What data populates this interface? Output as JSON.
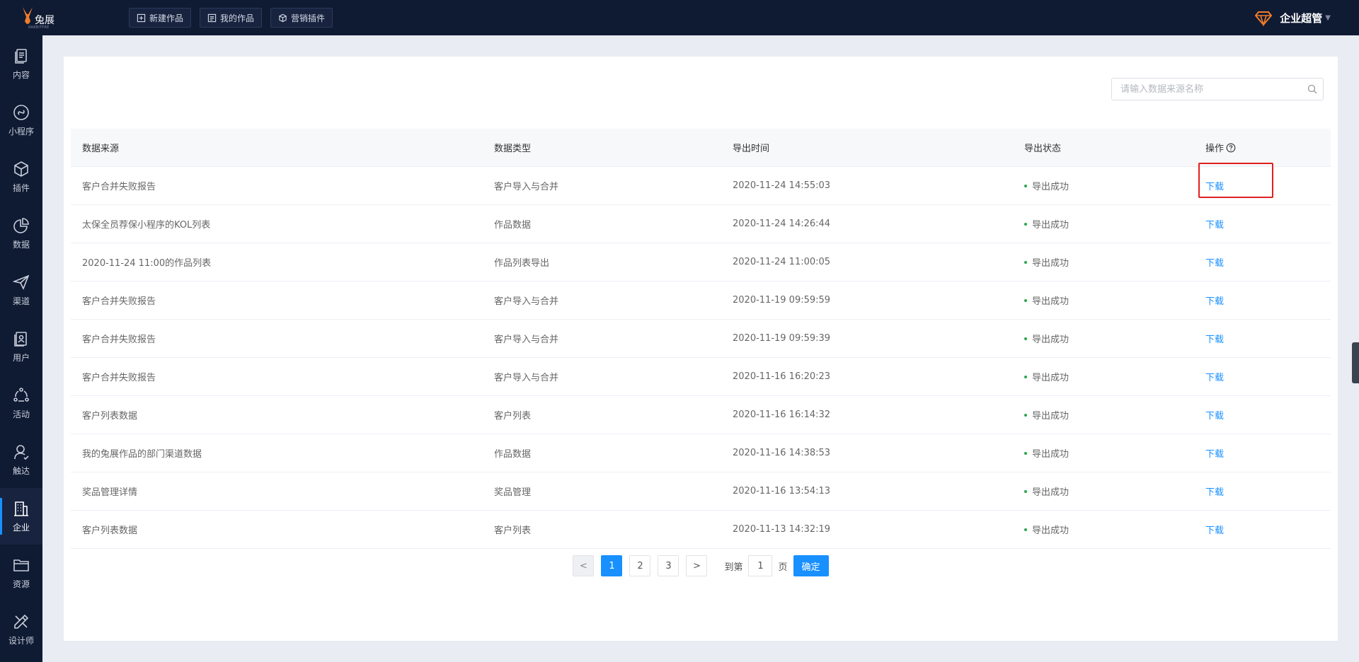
{
  "app": {
    "logo_text": "兔展",
    "logo_sub": "RABBITPRE"
  },
  "top_nav": [
    {
      "label": "新建作品",
      "icon": "plus-square-icon"
    },
    {
      "label": "我的作品",
      "icon": "doc-list-icon"
    },
    {
      "label": "营销插件",
      "icon": "cube-icon"
    }
  ],
  "user": {
    "name": "企业超管",
    "icon": "gem-icon"
  },
  "sidebar": {
    "items": [
      {
        "label": "内容",
        "icon": "content-icon"
      },
      {
        "label": "小程序",
        "icon": "miniprogram-icon"
      },
      {
        "label": "插件",
        "icon": "plugin-icon"
      },
      {
        "label": "数据",
        "icon": "pie-chart-icon"
      },
      {
        "label": "渠道",
        "icon": "send-icon"
      },
      {
        "label": "用户",
        "icon": "user-card-icon"
      },
      {
        "label": "活动",
        "icon": "activity-icon"
      },
      {
        "label": "触达",
        "icon": "reach-icon"
      },
      {
        "label": "企业",
        "icon": "building-icon",
        "active": true
      },
      {
        "label": "资源",
        "icon": "folder-icon"
      },
      {
        "label": "设计师",
        "icon": "designer-icon"
      }
    ]
  },
  "search": {
    "placeholder": "请输入数据来源名称",
    "value": ""
  },
  "table": {
    "headers": {
      "source": "数据来源",
      "type": "数据类型",
      "time": "导出时间",
      "status": "导出状态",
      "action": "操作"
    },
    "rows": [
      {
        "source": "客户合并失败报告",
        "type": "客户导入与合并",
        "time": "2020-11-24 14:55:03",
        "status": "导出成功",
        "action": "下载"
      },
      {
        "source": "太保全员荐保小程序的KOL列表",
        "type": "作品数据",
        "time": "2020-11-24 14:26:44",
        "status": "导出成功",
        "action": "下载"
      },
      {
        "source": "2020-11-24 11:00的作品列表",
        "type": "作品列表导出",
        "time": "2020-11-24 11:00:05",
        "status": "导出成功",
        "action": "下载"
      },
      {
        "source": "客户合并失败报告",
        "type": "客户导入与合并",
        "time": "2020-11-19 09:59:59",
        "status": "导出成功",
        "action": "下载"
      },
      {
        "source": "客户合并失败报告",
        "type": "客户导入与合并",
        "time": "2020-11-19 09:59:39",
        "status": "导出成功",
        "action": "下载"
      },
      {
        "source": "客户合并失败报告",
        "type": "客户导入与合并",
        "time": "2020-11-16 16:20:23",
        "status": "导出成功",
        "action": "下载"
      },
      {
        "source": "客户列表数据",
        "type": "客户列表",
        "time": "2020-11-16 16:14:32",
        "status": "导出成功",
        "action": "下载"
      },
      {
        "source": "我的兔展作品的部门渠道数据",
        "type": "作品数据",
        "time": "2020-11-16 14:38:53",
        "status": "导出成功",
        "action": "下载"
      },
      {
        "source": "奖品管理详情",
        "type": "奖品管理",
        "time": "2020-11-16 13:54:13",
        "status": "导出成功",
        "action": "下载"
      },
      {
        "source": "客户列表数据",
        "type": "客户列表",
        "time": "2020-11-13 14:32:19",
        "status": "导出成功",
        "action": "下载"
      }
    ]
  },
  "pagination": {
    "prev": "<",
    "next": ">",
    "pages": [
      "1",
      "2",
      "3"
    ],
    "current": "1",
    "goto_prefix": "到第",
    "goto_value": "1",
    "goto_suffix": "页",
    "confirm": "确定"
  },
  "colors": {
    "topbar": "#0f1a33",
    "accent": "#1890ff",
    "success": "#2da44e",
    "highlight": "#e02020"
  }
}
